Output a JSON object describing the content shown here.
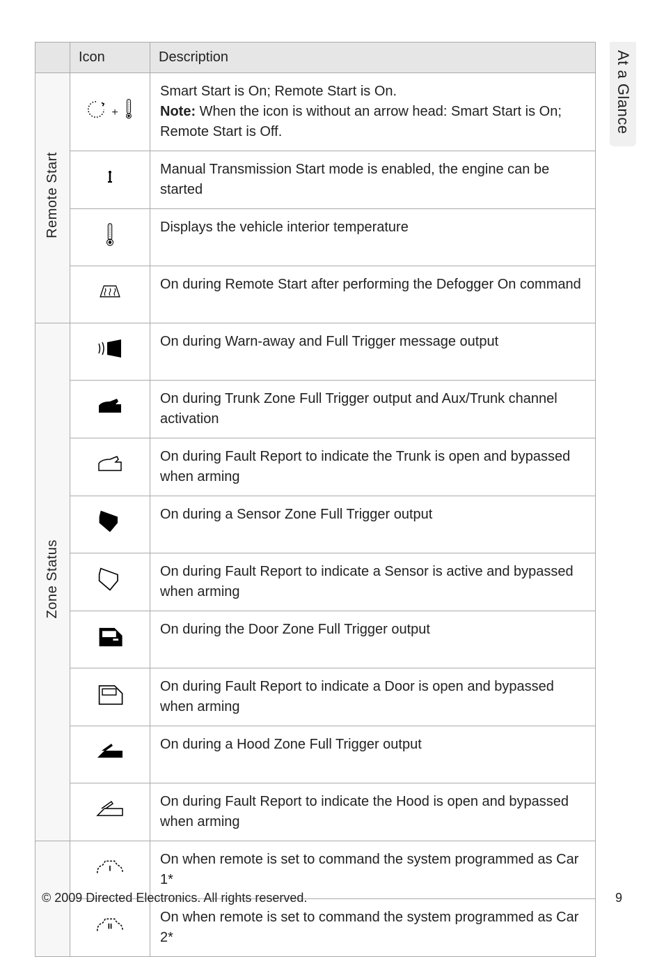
{
  "sideTab": "At a Glance",
  "headers": {
    "icon": "Icon",
    "description": "Description"
  },
  "groups": [
    {
      "label": "Remote Start",
      "rows": [
        {
          "iconName": "smart-start-remote-start-icon",
          "desc_pre": "Smart Start is On; Remote Start is On.",
          "note_label": "Note:",
          "desc_post": " When the icon is without an arrow head: Smart Start is On; Remote Start is Off."
        },
        {
          "iconName": "manual-transmission-icon",
          "desc": "Manual Transmission Start mode is enabled, the engine can be started"
        },
        {
          "iconName": "thermometer-icon",
          "desc": "Displays the vehicle interior temperature"
        },
        {
          "iconName": "defogger-icon",
          "desc": "On during Remote Start after performing the  Defogger On command"
        }
      ]
    },
    {
      "label": "Zone Status",
      "rows": [
        {
          "iconName": "siren-icon",
          "desc": "On during Warn-away and Full Trigger message output"
        },
        {
          "iconName": "trunk-solid-icon",
          "desc": "On during Trunk Zone Full Trigger output and Aux/Trunk channel activation"
        },
        {
          "iconName": "trunk-outline-icon",
          "desc": "On during Fault Report to indicate the Trunk is open and bypassed when arming"
        },
        {
          "iconName": "sensor-solid-icon",
          "desc": "On during a Sensor Zone Full Trigger output"
        },
        {
          "iconName": "sensor-outline-icon",
          "desc": "On during Fault Report to indicate a Sensor is active and bypassed when arming"
        },
        {
          "iconName": "door-solid-icon",
          "desc": "On during the Door Zone Full Trigger output"
        },
        {
          "iconName": "door-outline-icon",
          "desc": "On during Fault Report to indicate a Door is open and bypassed when arming"
        },
        {
          "iconName": "hood-solid-icon",
          "desc": "On during a Hood Zone Full Trigger output"
        },
        {
          "iconName": "hood-outline-icon",
          "desc": "On during Fault Report to indicate the Hood is open and bypassed when arming"
        }
      ]
    },
    {
      "label": "",
      "rows": [
        {
          "iconName": "car1-icon",
          "desc": "On when remote is set to command the system programmed as Car 1*"
        },
        {
          "iconName": "car2-icon",
          "desc": "On when remote is set to command the system programmed as Car 2*"
        }
      ]
    }
  ],
  "footer": {
    "copyright": "© 2009 Directed Electronics. All rights reserved.",
    "page": "9"
  }
}
